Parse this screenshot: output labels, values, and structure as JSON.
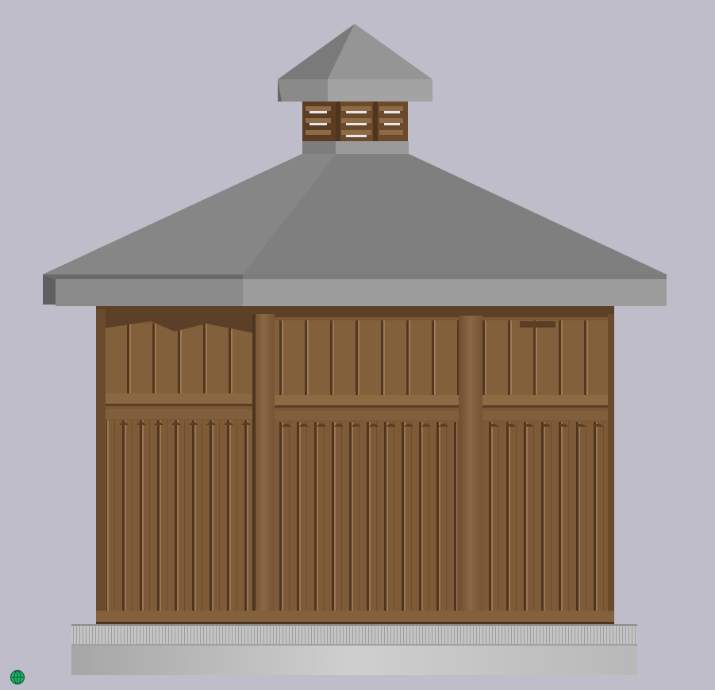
{
  "viewport": {
    "background": "#bfbdc9"
  },
  "colors": {
    "roof_front": "#7c7c7c",
    "roof_left": "#999999",
    "roof_right": "#6e6e6e",
    "roof_fascia_front": "#8a8a8a",
    "roof_fascia_left": "#5a5a5a",
    "wood_light": "#8d6a45",
    "wood_mid": "#7a5a38",
    "wood_dark": "#5a3f24",
    "wood_shadow": "#4a3320",
    "base_light": "#d0d0d0",
    "base_dark": "#a9a9a9"
  },
  "icons": {
    "nav_widget": "globe-navigation-icon"
  }
}
